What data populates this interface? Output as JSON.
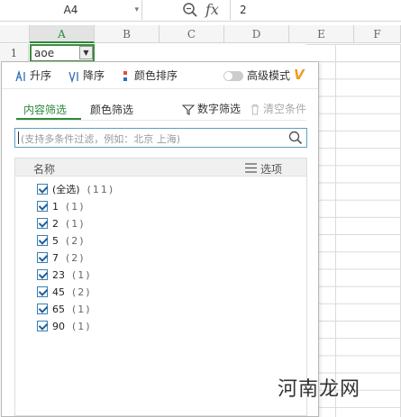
{
  "formula_bar": {
    "name_box": "A4",
    "formula_value": "2"
  },
  "sheet": {
    "columns": [
      "A",
      "B",
      "C",
      "D",
      "E",
      "F"
    ],
    "row_number": "1",
    "cell_a1": "aoe"
  },
  "toolbar": {
    "sort_asc": "升序",
    "sort_desc": "降序",
    "color_sort": "颜色排序",
    "advanced_mode": "高级模式",
    "vip_badge": "V"
  },
  "tabs": {
    "content_filter": "内容筛选",
    "color_filter": "颜色筛选",
    "number_filter": "数字筛选",
    "clear_conditions": "清空条件"
  },
  "search": {
    "placeholder": "(支持多条件过滤，例如：北京 上海)"
  },
  "list": {
    "header_name": "名称",
    "header_options": "选项",
    "items": [
      {
        "label": "(全选)",
        "count": "(11)"
      },
      {
        "label": "1",
        "count": "(1)"
      },
      {
        "label": "2",
        "count": "(1)"
      },
      {
        "label": "5",
        "count": "(2)"
      },
      {
        "label": "7",
        "count": "(2)"
      },
      {
        "label": "23",
        "count": "(1)"
      },
      {
        "label": "45",
        "count": "(2)"
      },
      {
        "label": "65",
        "count": "(1)"
      },
      {
        "label": "90",
        "count": "(1)"
      }
    ]
  },
  "watermark": "河南龙网",
  "colors": {
    "accent_green": "#2a8a3a",
    "checkbox_blue": "#3c7fb1",
    "vip_orange": "#f29b1e"
  }
}
